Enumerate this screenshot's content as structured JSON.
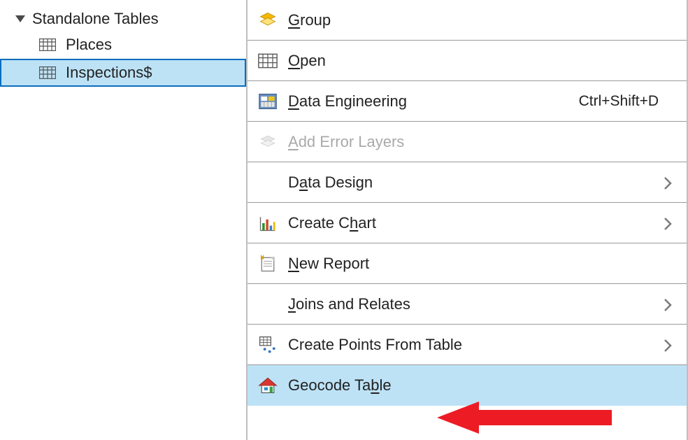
{
  "tree": {
    "header": "Standalone Tables",
    "items": [
      {
        "label": "Places"
      },
      {
        "label": "Inspections$"
      }
    ]
  },
  "menu": {
    "group": {
      "label": "Group",
      "mnemonic_index": 0
    },
    "open": {
      "label": "Open",
      "mnemonic_index": 0
    },
    "data_engineering": {
      "label": "Data Engineering",
      "shortcut": "Ctrl+Shift+D",
      "mnemonic_index": 0
    },
    "add_error_layers": {
      "label": "Add Error Layers",
      "mnemonic_index": 0
    },
    "data_design": {
      "label": "Data Design",
      "mnemonic_index": 1
    },
    "create_chart": {
      "label": "Create Chart",
      "mnemonic_index": 8
    },
    "new_report": {
      "label": "New Report",
      "mnemonic_index": 0
    },
    "joins_relates": {
      "label": "Joins and Relates",
      "mnemonic_index": 0
    },
    "create_points": {
      "label": "Create Points From Table"
    },
    "geocode_table": {
      "label": "Geocode Table",
      "mnemonic_index": 10
    }
  }
}
